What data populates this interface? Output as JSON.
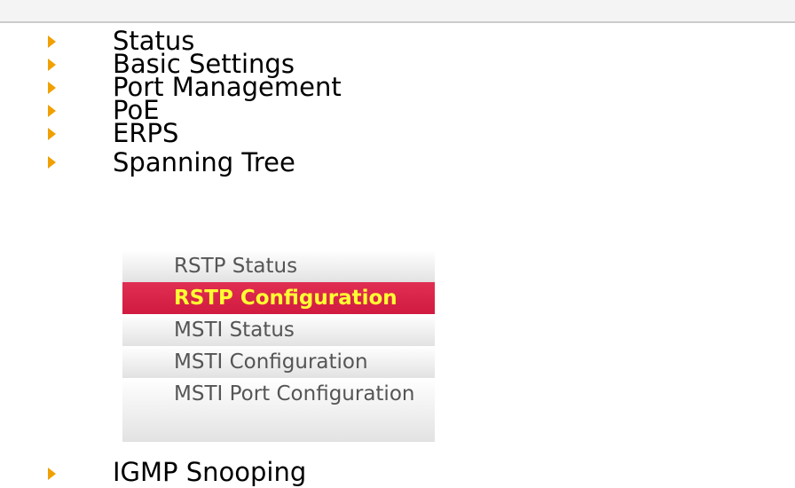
{
  "menu": {
    "items": [
      {
        "label": "Status"
      },
      {
        "label": "Basic Settings"
      },
      {
        "label": "Port Management"
      },
      {
        "label": "PoE"
      },
      {
        "label": "ERPS"
      },
      {
        "label": "Spanning Tree"
      }
    ],
    "submenu": [
      {
        "label": "RSTP Status"
      },
      {
        "label": "RSTP Configuration"
      },
      {
        "label": "MSTI Status"
      },
      {
        "label": "MSTI Configuration"
      },
      {
        "label": "MSTI Port Configuration"
      }
    ],
    "after": [
      {
        "label": "IGMP Snooping"
      }
    ]
  },
  "colors": {
    "arrow": "#f0a000",
    "active_bg": "#d11a40",
    "active_text": "#ffff33"
  }
}
